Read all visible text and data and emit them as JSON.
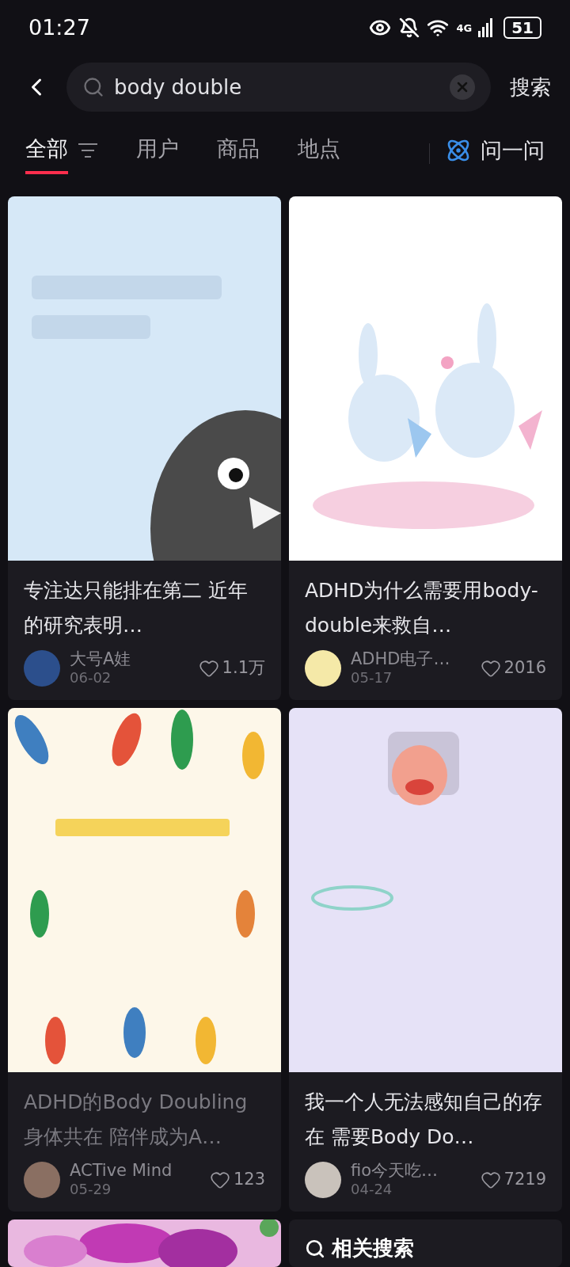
{
  "status_bar": {
    "time": "01:27",
    "network": "4G",
    "battery": "51"
  },
  "search": {
    "value": "body double",
    "action": "搜索"
  },
  "tabs": [
    {
      "label": "全部",
      "selected": true,
      "filter": true
    },
    {
      "label": "用户",
      "selected": false,
      "filter": false
    },
    {
      "label": "商品",
      "selected": false,
      "filter": false
    },
    {
      "label": "地点",
      "selected": false,
      "filter": false
    }
  ],
  "ask": {
    "label": "问一问"
  },
  "cards": [
    {
      "title": "专注达只能排在第二 近年的研究表明…",
      "author": "大号A娃",
      "date": "06-02",
      "likes": "1.1万",
      "visited": false
    },
    {
      "title": "ADHD为什么需要用body-double来救自…",
      "author": "ADHD电子…",
      "date": "05-17",
      "likes": "2016",
      "visited": false
    },
    {
      "title": "ADHD的Body Doubling身体共在 陪伴成为A…",
      "author": "ACTive Mind",
      "date": "05-29",
      "likes": "123",
      "visited": true
    },
    {
      "title": "我一个人无法感知自己的存在 需要Body Do…",
      "author": "fio今天吃…",
      "date": "04-24",
      "likes": "7219",
      "visited": false
    }
  ],
  "related": {
    "title": "相关搜索"
  }
}
